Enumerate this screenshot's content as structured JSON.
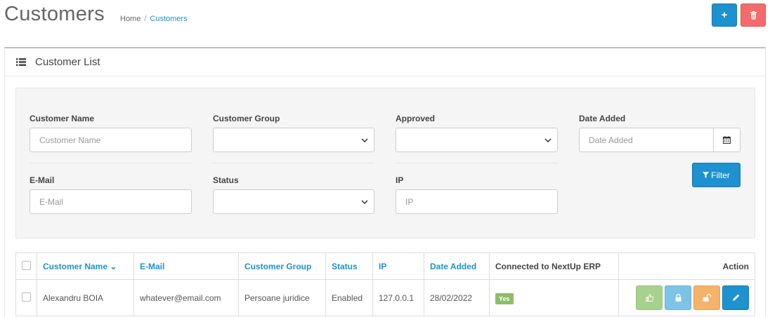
{
  "header": {
    "title": "Customers",
    "breadcrumb": [
      {
        "label": "Home"
      },
      {
        "label": "Customers"
      }
    ],
    "add_icon": "plus-icon",
    "delete_icon": "trash-icon",
    "add_symbol": "+"
  },
  "panel": {
    "title": "Customer List",
    "icon": "list-icon"
  },
  "filters": {
    "customer_name": {
      "label": "Customer Name",
      "placeholder": "Customer Name"
    },
    "customer_group": {
      "label": "Customer Group",
      "value": ""
    },
    "approved": {
      "label": "Approved",
      "value": ""
    },
    "date_added": {
      "label": "Date Added",
      "placeholder": "Date Added"
    },
    "email": {
      "label": "E-Mail",
      "placeholder": "E-Mail"
    },
    "status": {
      "label": "Status",
      "value": ""
    },
    "ip": {
      "label": "IP",
      "placeholder": "IP"
    },
    "filter_button": "Filter"
  },
  "table": {
    "columns": [
      "Customer Name",
      "E-Mail",
      "Customer Group",
      "Status",
      "IP",
      "Date Added",
      "Connected to NextUp ERP",
      "Action"
    ],
    "sort_indicator": "⌄",
    "rows": [
      {
        "name": "Alexandru BOIA",
        "email": "whatever@email.com",
        "group": "Persoane juridice",
        "status": "Enabled",
        "ip": "127.0.0.1",
        "date_added": "28/02/2022",
        "connected": "Yes"
      }
    ]
  },
  "colors": {
    "primary": "#1e91cf",
    "danger": "#f56b6b",
    "success": "#8fbb6c",
    "warning": "#f5b26b",
    "info": "#7cc3e8"
  }
}
